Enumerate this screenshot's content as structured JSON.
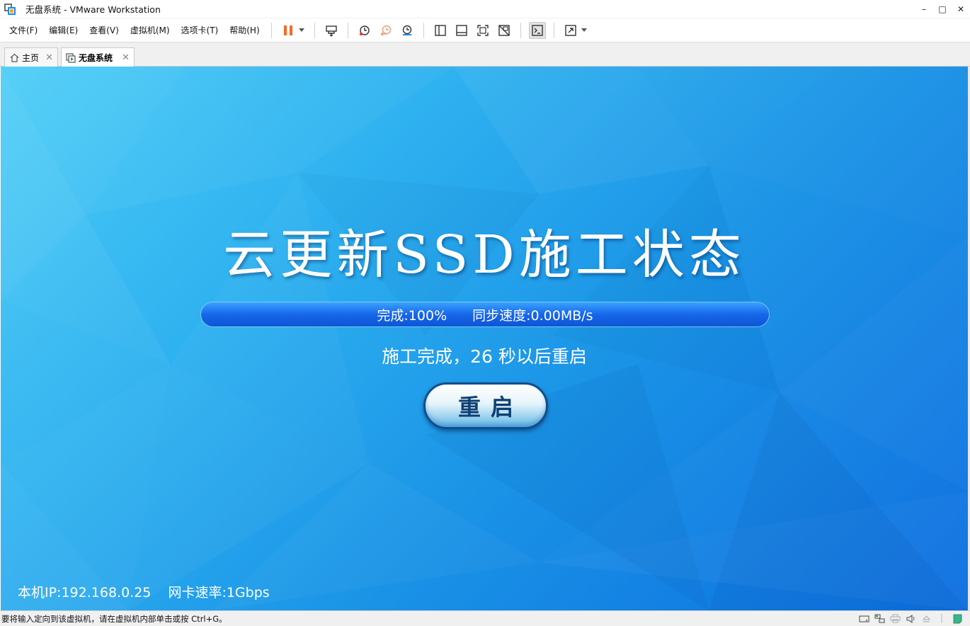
{
  "window": {
    "title": "无盘系统 - VMware Workstation",
    "minimize": "–",
    "maximize": "□",
    "close": "✕"
  },
  "menu": {
    "items": [
      "文件(F)",
      "编辑(E)",
      "查看(V)",
      "虚拟机(M)",
      "选项卡(T)",
      "帮助(H)"
    ]
  },
  "tabs": [
    {
      "label": "主页",
      "close": "✕"
    },
    {
      "label": "无盘系统",
      "close": "✕"
    }
  ],
  "vm": {
    "title": "云更新SSD施工状态",
    "progress": {
      "complete_label": "完成:100%",
      "speed_label": "同步速度:0.00MB/s",
      "percent": 100
    },
    "status": "施工完成，26 秒以后重启",
    "reboot_button": "重启",
    "ip_label": "本机IP:192.168.0.25",
    "nic_speed_label": "网卡速率:1Gbps"
  },
  "statusbar": {
    "message": "要将输入定向到该虚拟机，请在虚拟机内部单击或按 Ctrl+G。"
  },
  "colors": {
    "pause_orange": "#f26b21",
    "accent_blue": "#1e88e5"
  }
}
